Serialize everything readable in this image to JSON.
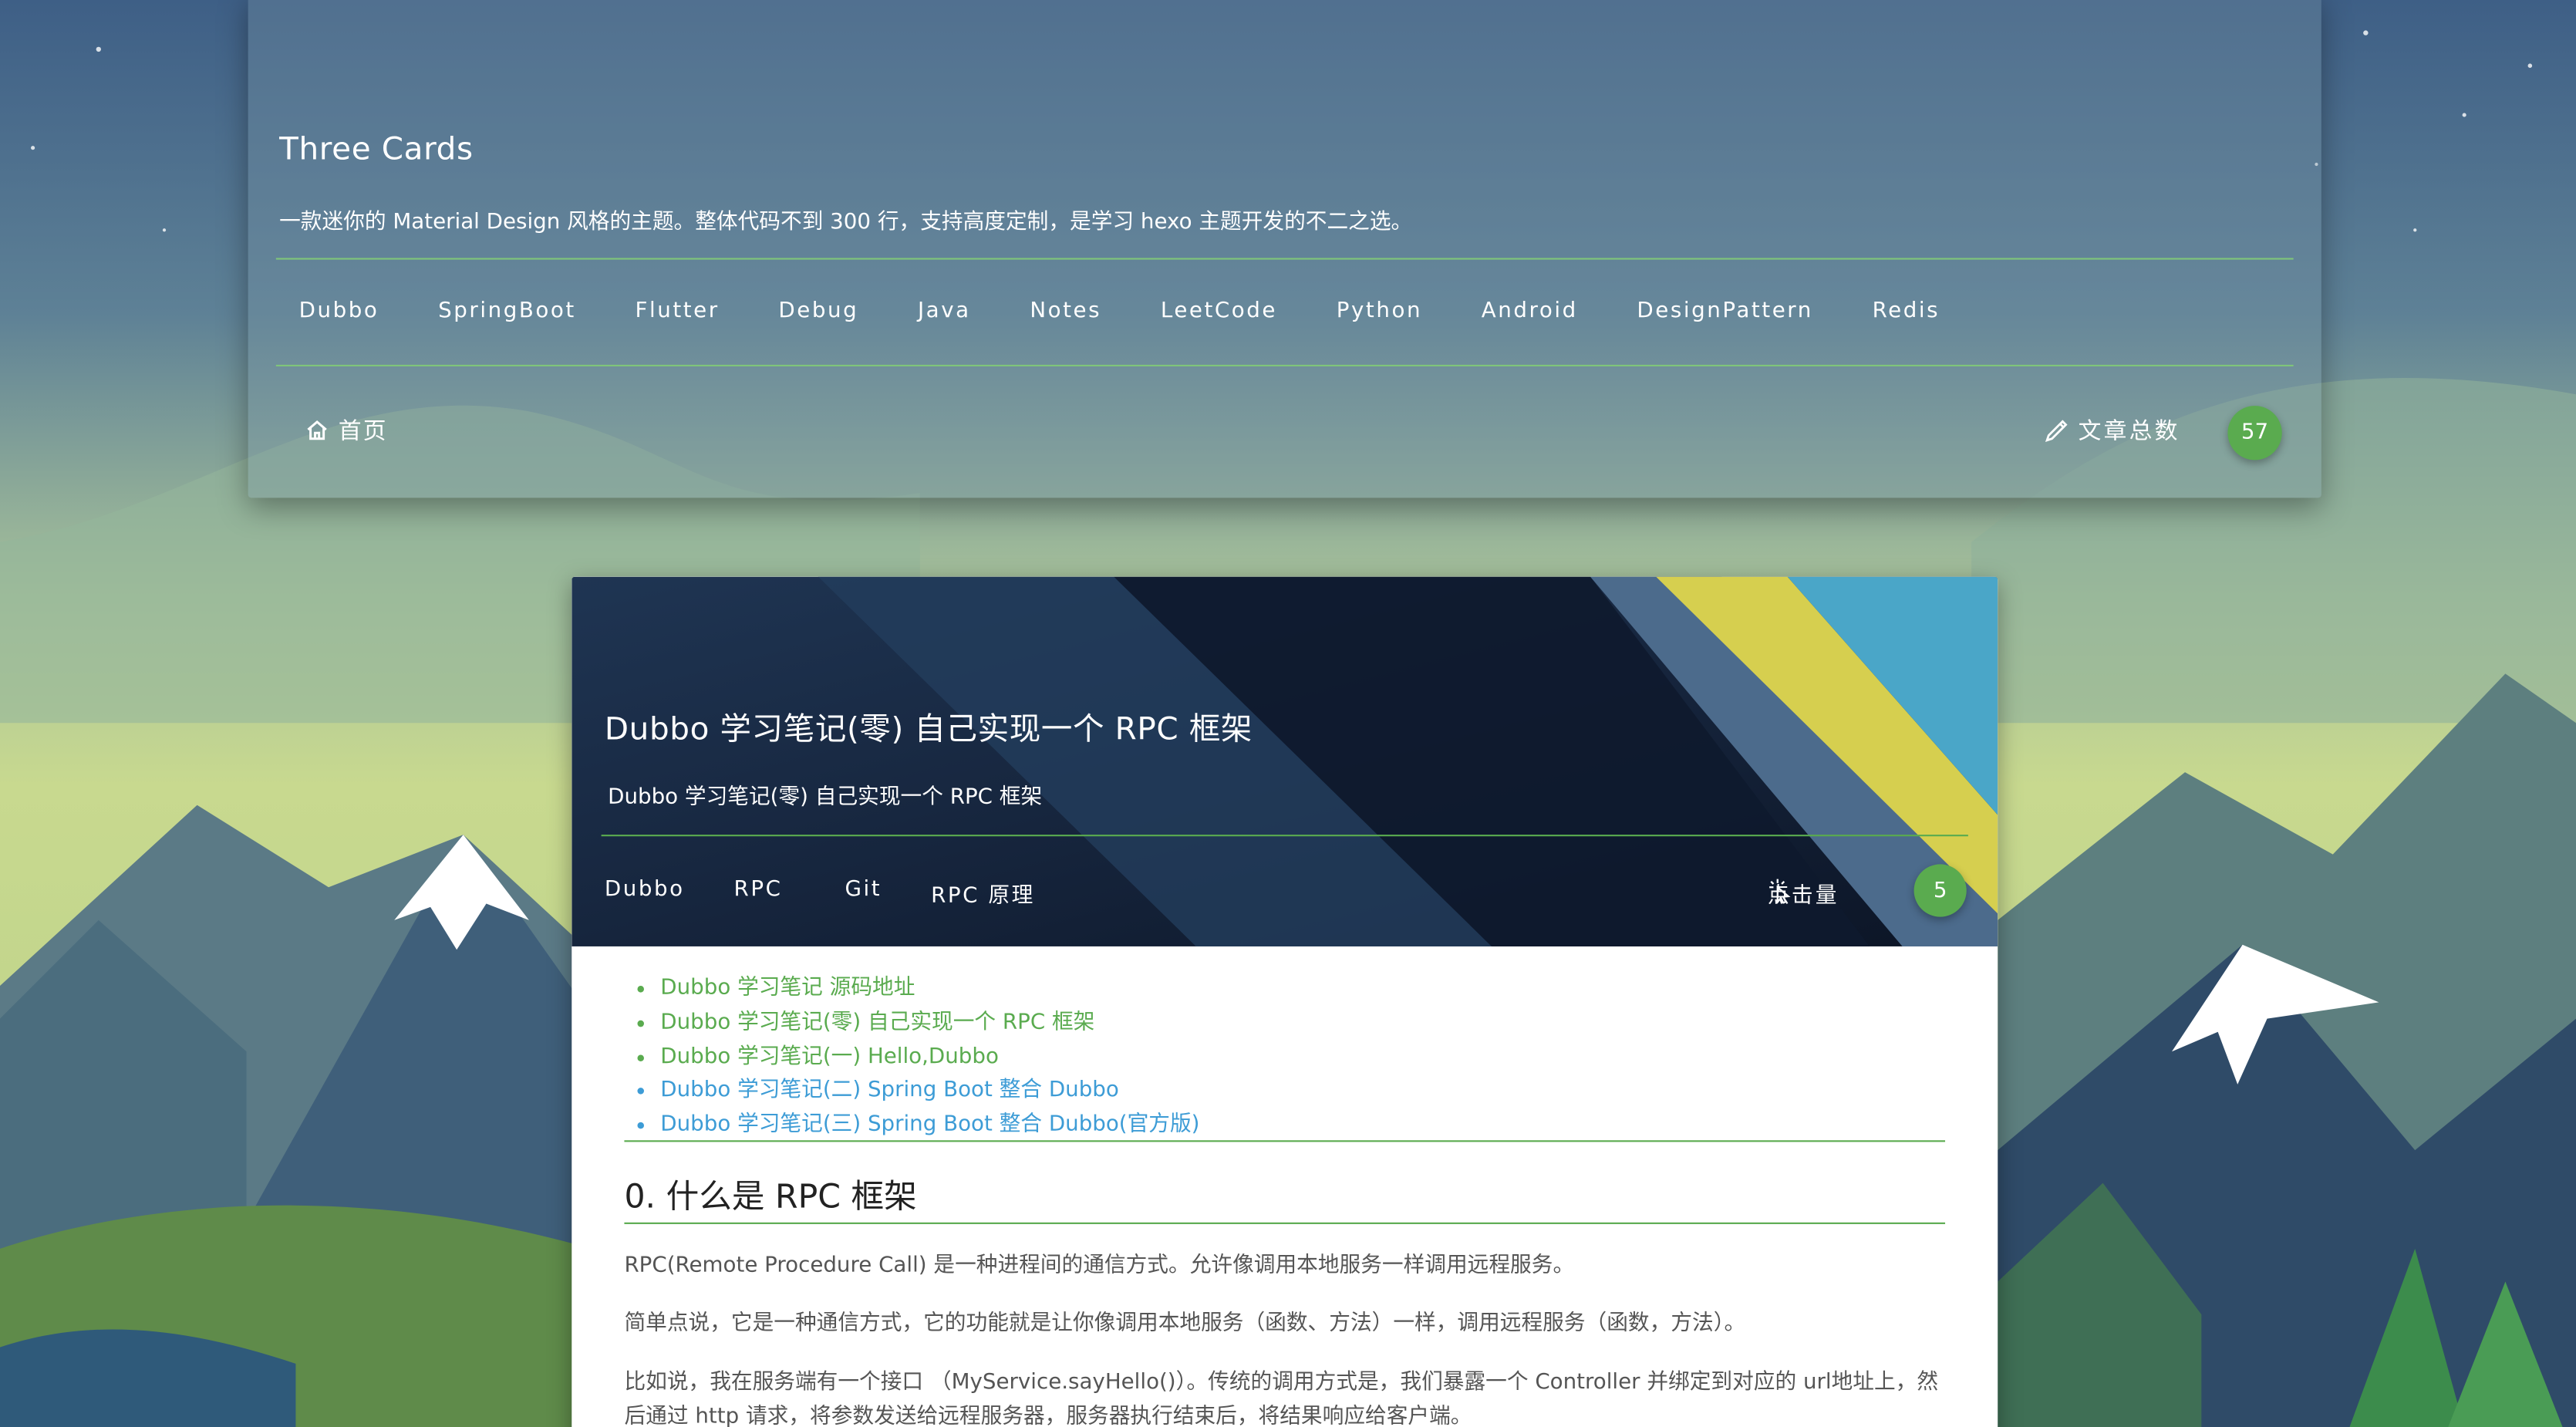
{
  "header": {
    "title": "Three Cards",
    "subtitle": "一款迷你的 Material Design 风格的主题。整体代码不到 300 行，支持高度定制，是学习 hexo 主题开发的不二之选。",
    "categories": [
      "Dubbo",
      "SpringBoot",
      "Flutter",
      "Debug",
      "Java",
      "Notes",
      "LeetCode",
      "Python",
      "Android",
      "DesignPattern",
      "Redis"
    ],
    "home_label": "首页",
    "post_count_label": "文章总数",
    "post_count": "57"
  },
  "post": {
    "title": "Dubbo 学习笔记(零) 自己实现一个 RPC 框架",
    "subtitle": "Dubbo 学习笔记(零) 自己实现一个 RPC 框架",
    "tags": [
      "Dubbo",
      "RPC",
      "Git",
      "RPC 原理"
    ],
    "views_label": "点击量",
    "views": "5",
    "toc": [
      "Dubbo 学习笔记 源码地址",
      "Dubbo 学习笔记(零) 自己实现一个 RPC 框架",
      "Dubbo 学习笔记(一) Hello,Dubbo",
      "Dubbo 学习笔记(二) Spring Boot 整合 Dubbo",
      "Dubbo 学习笔记(三) Spring Boot 整合 Dubbo(官方版)"
    ],
    "section_title": "0. 什么是 RPC 框架",
    "paragraphs": [
      "RPC(Remote Procedure Call) 是一种进程间的通信方式。允许像调用本地服务一样调用远程服务。",
      "简单点说，它是一种通信方式，它的功能就是让你像调用本地服务（函数、方法）一样，调用远程服务（函数，方法）。",
      "比如说，我在服务端有一个接口 （MyService.sayHello()）。传统的调用方式是，我们暴露一个 Controller 并绑定到对应的 url地址上，然后通过 http 请求，将参数发送给远程服务器，服务器执行结束后，将结果响应给客户端。"
    ]
  },
  "colors": {
    "accent_green": "#5aab4f",
    "link_blue": "#3d9cd6"
  }
}
